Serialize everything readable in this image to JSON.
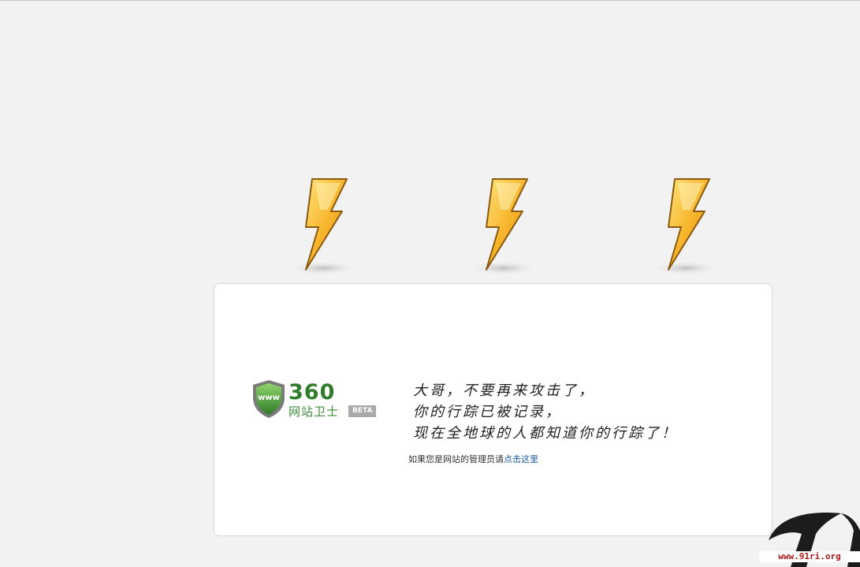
{
  "bolts": [
    {
      "icon": "lightning-bolt-icon"
    },
    {
      "icon": "lightning-bolt-icon"
    },
    {
      "icon": "lightning-bolt-icon"
    }
  ],
  "logo": {
    "number": "360",
    "name": "网站卫士",
    "badge": "BETA",
    "shield_text": "www",
    "icon": "shield-icon"
  },
  "message": {
    "lines": [
      "大哥，不要再来攻击了，",
      "你的行踪已被记录，",
      "现在全地球的人都知道你的行踪了！"
    ]
  },
  "admin_note": {
    "prefix": "如果您是网站的管理员请",
    "link_label": "点击这里"
  },
  "watermark": {
    "text": "www.91ri.org"
  },
  "colors": {
    "background": "#f2f2f2",
    "card": "#ffffff",
    "brand_green": "#2f7d2a",
    "link_blue": "#1a5a9e",
    "bolt_orange": "#f5a623",
    "watermark_red": "#b01818"
  }
}
